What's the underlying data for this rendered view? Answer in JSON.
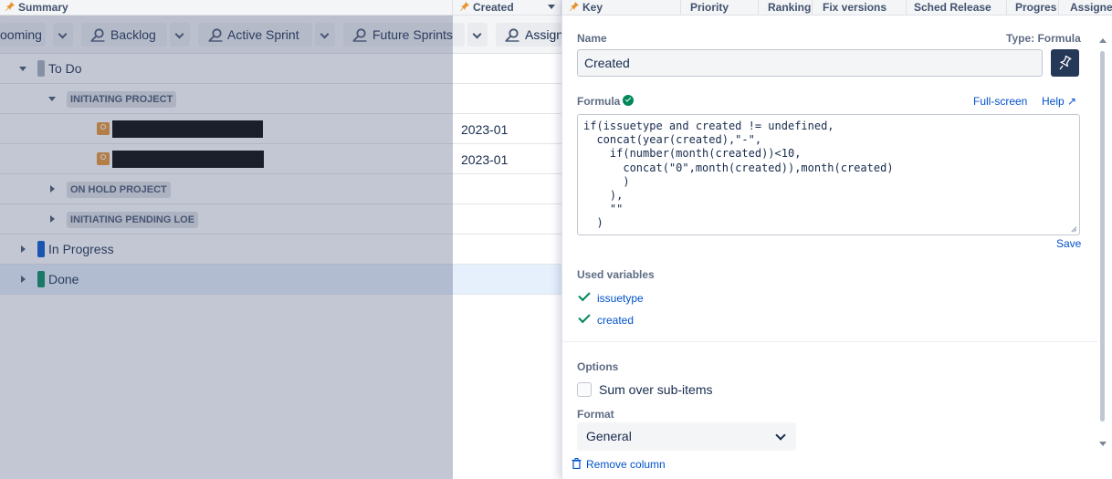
{
  "header": {
    "columns": [
      "Summary",
      "Created",
      "Key",
      "Priority",
      "Ranking",
      "Fix versions",
      "Sched Release",
      "Progres",
      "Assignee"
    ]
  },
  "toolbar": {
    "upcoming_label": "ooming",
    "backlog_label": "Backlog",
    "active_sprint_label": "Active Sprint",
    "future_sprints_label": "Future Sprints",
    "assign_label": "Assign"
  },
  "grid": {
    "groups": {
      "todo": "To Do",
      "initiating_project": "INITIATING PROJECT",
      "on_hold_project": "ON HOLD PROJECT",
      "initiating_pending_loe": "INITIATING PENDING LOE",
      "in_progress": "In Progress",
      "done": "Done"
    },
    "issues": [
      {
        "created": "2023-01"
      },
      {
        "created": "2023-01"
      }
    ],
    "status_colors": {
      "todo": "#a5adba",
      "in_progress": "#0052cc",
      "done": "#00875a"
    }
  },
  "panel": {
    "name_label": "Name",
    "type_label": "Type: Formula",
    "name_value": "Created",
    "formula_label": "Formula",
    "fullscreen_label": "Full-screen",
    "help_label": "Help ↗",
    "formula_text": "if(issuetype and created != undefined,\n  concat(year(created),\"-\",\n    if(number(month(created))<10,\n      concat(\"0\",month(created)),month(created)\n      )\n    ),\n    \"\"\n  )",
    "save_label": "Save",
    "used_variables_label": "Used variables",
    "variables": [
      "issuetype",
      "created"
    ],
    "options_label": "Options",
    "sum_label": "Sum over sub-items",
    "format_label": "Format",
    "format_value": "General",
    "remove_label": "Remove column"
  }
}
